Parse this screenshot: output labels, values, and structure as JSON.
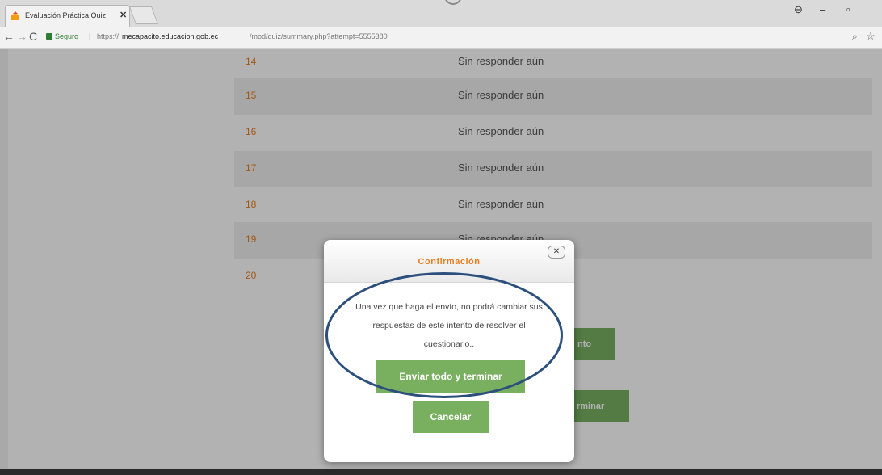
{
  "browser": {
    "tab_title": "Evaluación Práctica Quiz",
    "tab_close": "✕",
    "nav": {
      "back": "←",
      "forward": "→",
      "reload": "C"
    },
    "secure_label": "Seguro",
    "url_separator": "|",
    "url_scheme": "https://",
    "url_host": "mecapacito.educacion.gob.ec",
    "url_path": "/mod/quiz/summary.php?attempt=5555380",
    "window_controls": {
      "user": "⊖",
      "minimize": "–",
      "maximize": "▫"
    },
    "icons": {
      "zoom": "⌕",
      "bookmark": "☆"
    }
  },
  "questions": [
    {
      "number": "14",
      "status": "Sin responder aún"
    },
    {
      "number": "15",
      "status": "Sin responder aún"
    },
    {
      "number": "16",
      "status": "Sin responder aún"
    },
    {
      "number": "17",
      "status": "Sin responder aún"
    },
    {
      "number": "18",
      "status": "Sin responder aún"
    },
    {
      "number": "19",
      "status": "Sin responder aún"
    },
    {
      "number": "20",
      "status": ""
    }
  ],
  "background_buttons": {
    "return_partial": "nto",
    "submit_partial": "rminar"
  },
  "modal": {
    "title": "Confirmación",
    "close": "✕",
    "message": "Una vez que haga el envío, no podrá cambiar sus respuestas de este intento de resolver el cuestionario..",
    "submit_button": "Enviar todo y terminar",
    "cancel_button": "Cancelar"
  },
  "colors": {
    "accent_orange": "#e67e22",
    "button_green": "#78b060",
    "annotation_blue": "#2c4f7c"
  }
}
